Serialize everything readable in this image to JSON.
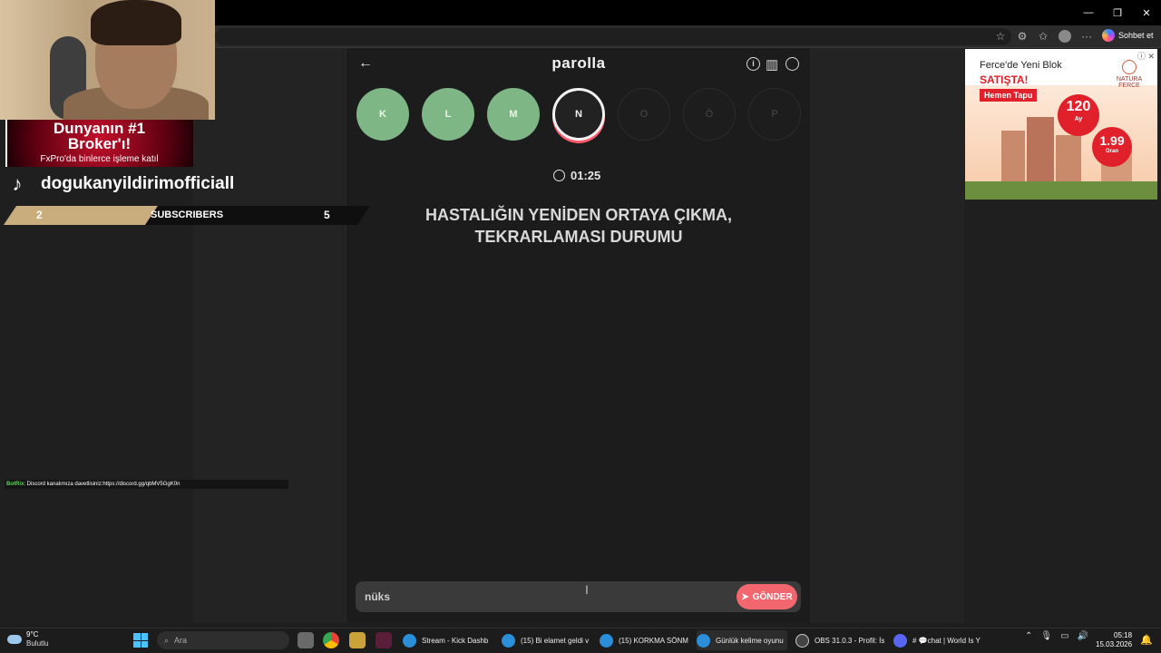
{
  "window": {
    "controls": {
      "minimize": "—",
      "maximize": "❐",
      "close": "✕"
    }
  },
  "toolbar": {
    "copilot_label": "Sohbet et",
    "icons": [
      "star-icon",
      "extensions-icon",
      "favorites-icon",
      "profile-icon",
      "more-icon"
    ]
  },
  "game": {
    "title": "parolla",
    "back_icon": "←",
    "header_icons": {
      "info": "i",
      "stats": "▥",
      "account": "◉"
    },
    "letters": [
      {
        "label": "K",
        "state": "done"
      },
      {
        "label": "L",
        "state": "done"
      },
      {
        "label": "M",
        "state": "done"
      },
      {
        "label": "N",
        "state": "active"
      },
      {
        "label": "O",
        "state": "pending"
      },
      {
        "label": "Ö",
        "state": "pending"
      },
      {
        "label": "P",
        "state": "pending"
      }
    ],
    "timer": "01:25",
    "question_line1": "HASTALIĞIN YENİDEN ORTAYA ÇIKMA,",
    "question_line2": "TEKRARLAMASI DURUMU",
    "answer_value": "nüks",
    "send_label": "GÖNDER",
    "colors": {
      "done": "#7fb685",
      "active_ring": "#ff5a6a",
      "send": "#f2666e"
    }
  },
  "overlay": {
    "ad_line1": "Dunyanın #1",
    "ad_line2": "Broker'ı!",
    "ad_line3": "FxPro'da binlerce işleme katıl",
    "tiktok_user": "dogukanyildirimofficiall",
    "sub_left": "2",
    "sub_label": "SUBSCRIBERS",
    "sub_right": "5",
    "chat_bot": "BotRix",
    "chat_message": ": Discord kanalımıza davetlisiniz:https://discord.gg/qbMV5GgK0n"
  },
  "side_ad": {
    "line1": "Ferce'de Yeni Blok",
    "line2": "SATIŞTA!",
    "line3": "Hemen Tapu",
    "brand": "NATURA FERCE",
    "num": "120",
    "num_sub": "Ay",
    "rate": "1.99",
    "rate_sub": "Oran"
  },
  "taskbar": {
    "weather_temp": "9°C",
    "weather_desc": "Bulutlu",
    "search_placeholder": "Ara",
    "tasks": [
      "Stream - Kick Dashb",
      "(15) Bi elamet geldi v",
      "(15) KORKMA SÖNM",
      "Günlük kelime oyunu",
      "OBS 31.0.3 - Profil: İs",
      "# 💬chat | World Is Y"
    ],
    "time": "05:18",
    "date": "15.03.2026"
  }
}
